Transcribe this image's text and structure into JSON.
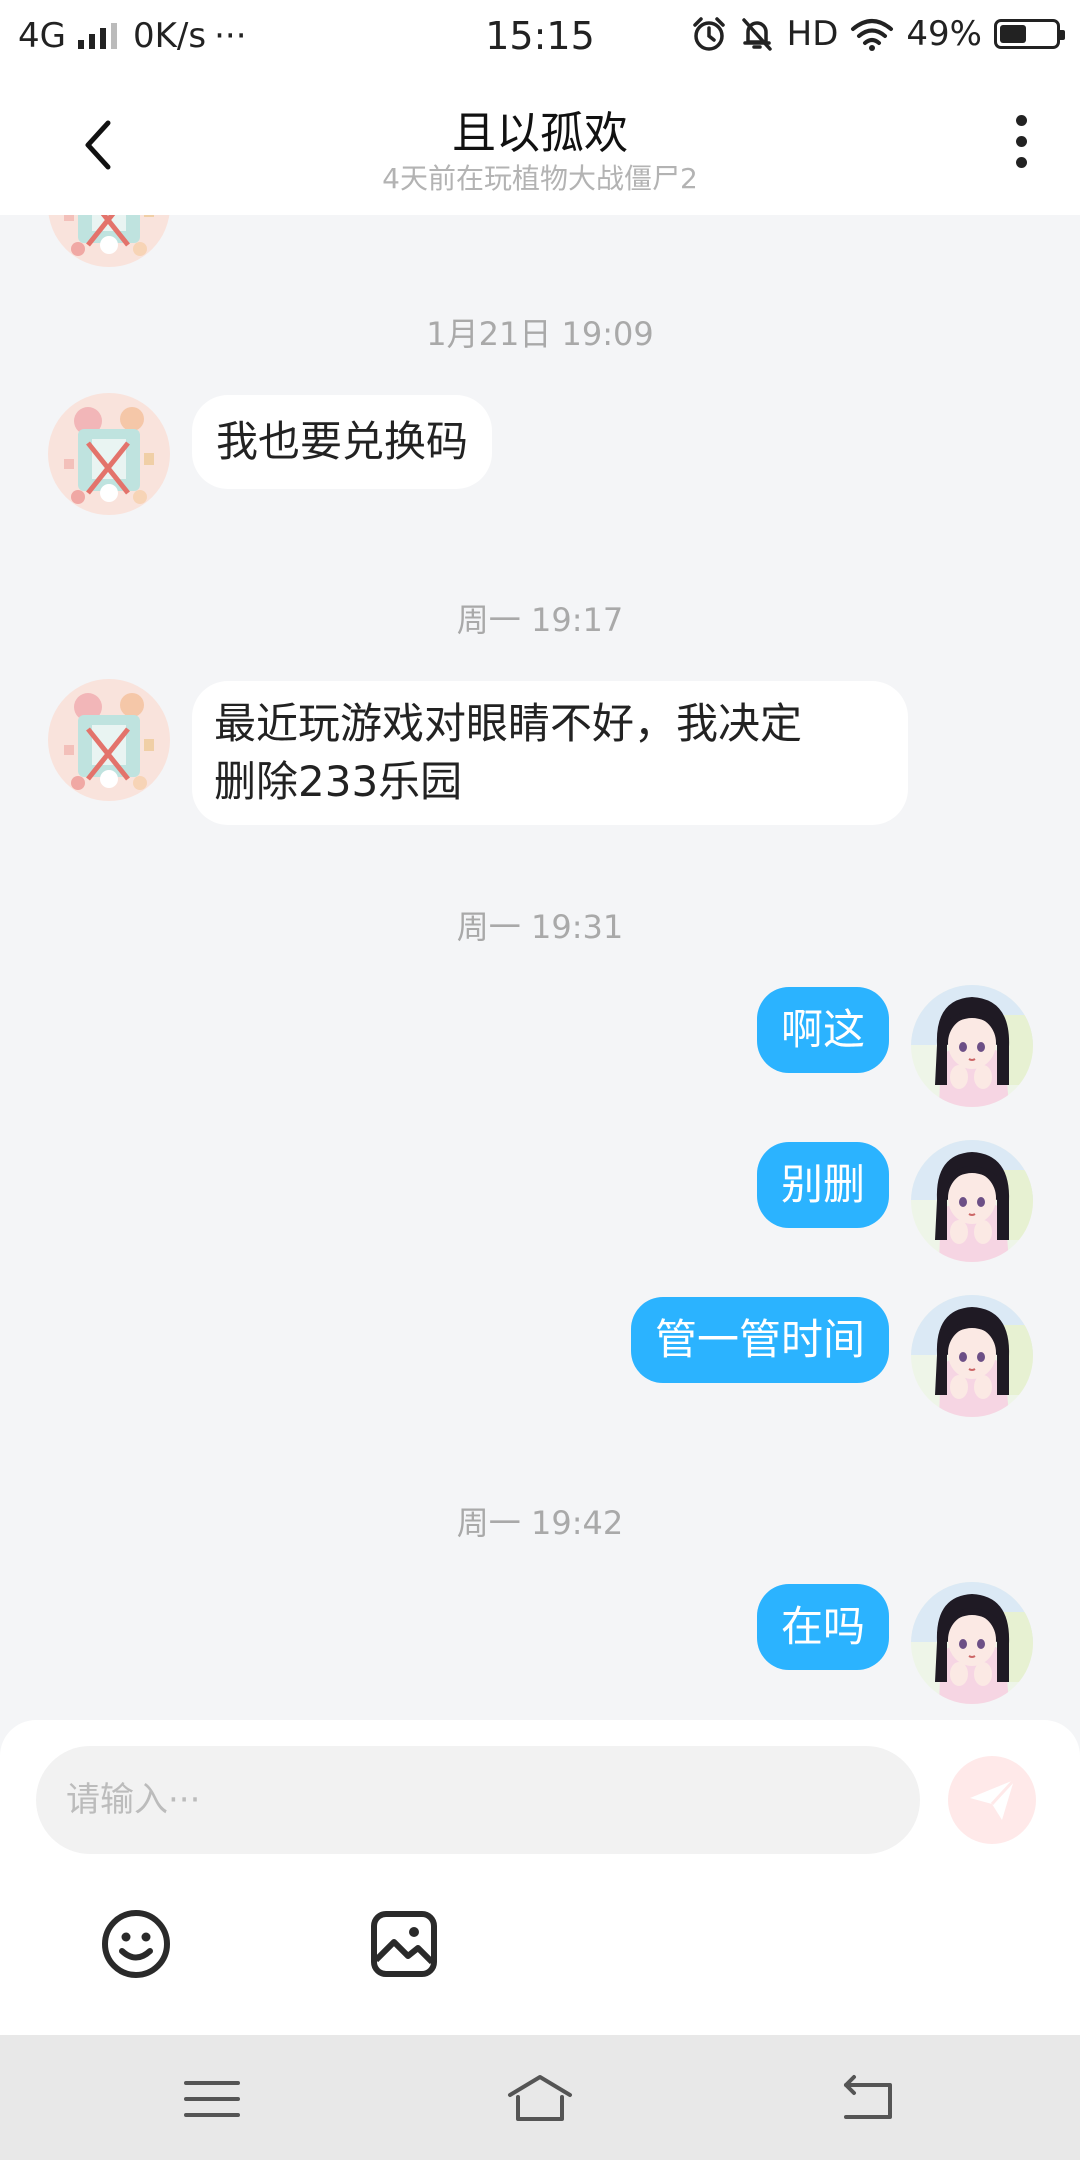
{
  "status_bar": {
    "network": "4G",
    "speed": "0K/s",
    "more": "···",
    "time": "15:15",
    "hd": "HD",
    "battery": "49%",
    "battery_level": 0.49
  },
  "header": {
    "title": "且以孤欢",
    "subtitle": "4天前在玩植物大战僵尸2"
  },
  "chat": {
    "timestamps": [
      "1月21日 19:09",
      "周一 19:17",
      "周一 19:31",
      "周一 19:42"
    ],
    "incoming": [
      {
        "lines": [
          "我也要兑换码"
        ]
      },
      {
        "lines": [
          "最近玩游戏对眼睛不好，我决定",
          "删除233乐园"
        ]
      }
    ],
    "outgoing": [
      "啊这",
      "别删",
      "管一管时间",
      "在吗"
    ]
  },
  "input": {
    "placeholder": "请输入···"
  },
  "colors": {
    "outgoing_bubble": "#2bb3ff",
    "incoming_bubble": "#ffffff",
    "send_button": "#ffe9e9",
    "background": "#f4f5f7"
  },
  "icons": {
    "back": "chevron-left-icon",
    "more": "more-vertical-icon",
    "send": "paper-plane-icon",
    "emoji": "emoji-icon",
    "image": "image-icon",
    "nav_menu": "menu-icon",
    "nav_home": "home-icon",
    "nav_back": "back-icon"
  }
}
